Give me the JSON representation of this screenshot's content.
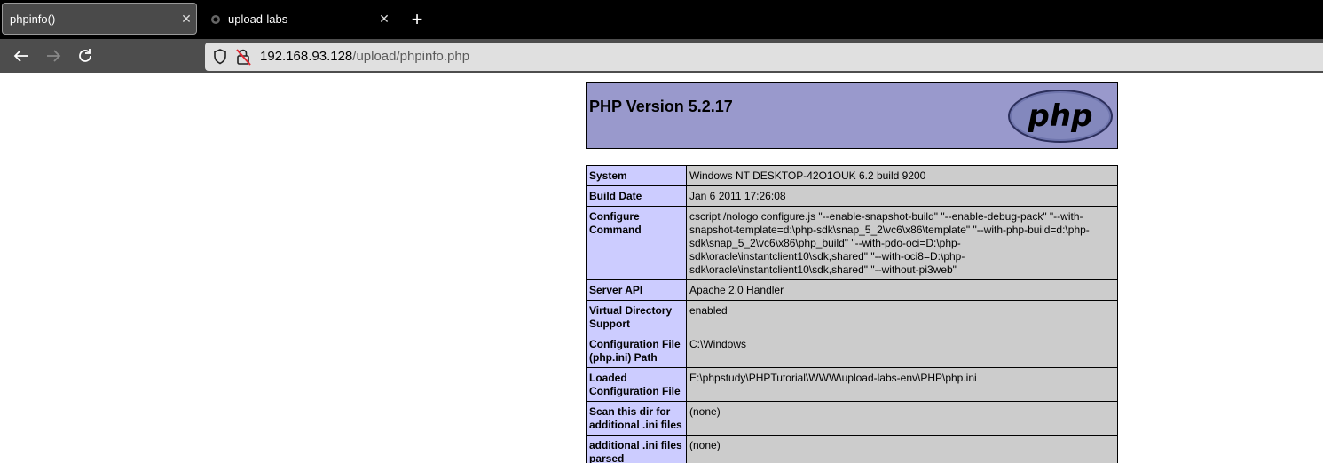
{
  "tabs": [
    {
      "label": "phpinfo()",
      "active": true
    },
    {
      "label": "upload-labs",
      "active": false
    }
  ],
  "address": {
    "host": "192.168.93.128",
    "path": "/upload/phpinfo.php"
  },
  "php": {
    "version_title": "PHP Version 5.2.17",
    "logo_text": "php",
    "rows": [
      {
        "key": "System",
        "value": "Windows NT DESKTOP-42O1OUK 6.2 build 9200"
      },
      {
        "key": "Build Date",
        "value": "Jan 6 2011 17:26:08"
      },
      {
        "key": "Configure Command",
        "value": "cscript /nologo configure.js \"--enable-snapshot-build\" \"--enable-debug-pack\" \"--with-snapshot-template=d:\\php-sdk\\snap_5_2\\vc6\\x86\\template\" \"--with-php-build=d:\\php-sdk\\snap_5_2\\vc6\\x86\\php_build\" \"--with-pdo-oci=D:\\php-sdk\\oracle\\instantclient10\\sdk,shared\" \"--with-oci8=D:\\php-sdk\\oracle\\instantclient10\\sdk,shared\" \"--without-pi3web\""
      },
      {
        "key": "Server API",
        "value": "Apache 2.0 Handler"
      },
      {
        "key": "Virtual Directory Support",
        "value": "enabled"
      },
      {
        "key": "Configuration File (php.ini) Path",
        "value": "C:\\Windows"
      },
      {
        "key": "Loaded Configuration File",
        "value": "E:\\phpstudy\\PHPTutorial\\WWW\\upload-labs-env\\PHP\\php.ini"
      },
      {
        "key": "Scan this dir for additional .ini files",
        "value": "(none)"
      },
      {
        "key": "additional .ini files parsed",
        "value": "(none)"
      },
      {
        "key": "",
        "value": ""
      }
    ]
  },
  "colors": {
    "header_bg": "#9999cc",
    "key_bg": "#ccccff",
    "value_bg": "#cccccc"
  }
}
